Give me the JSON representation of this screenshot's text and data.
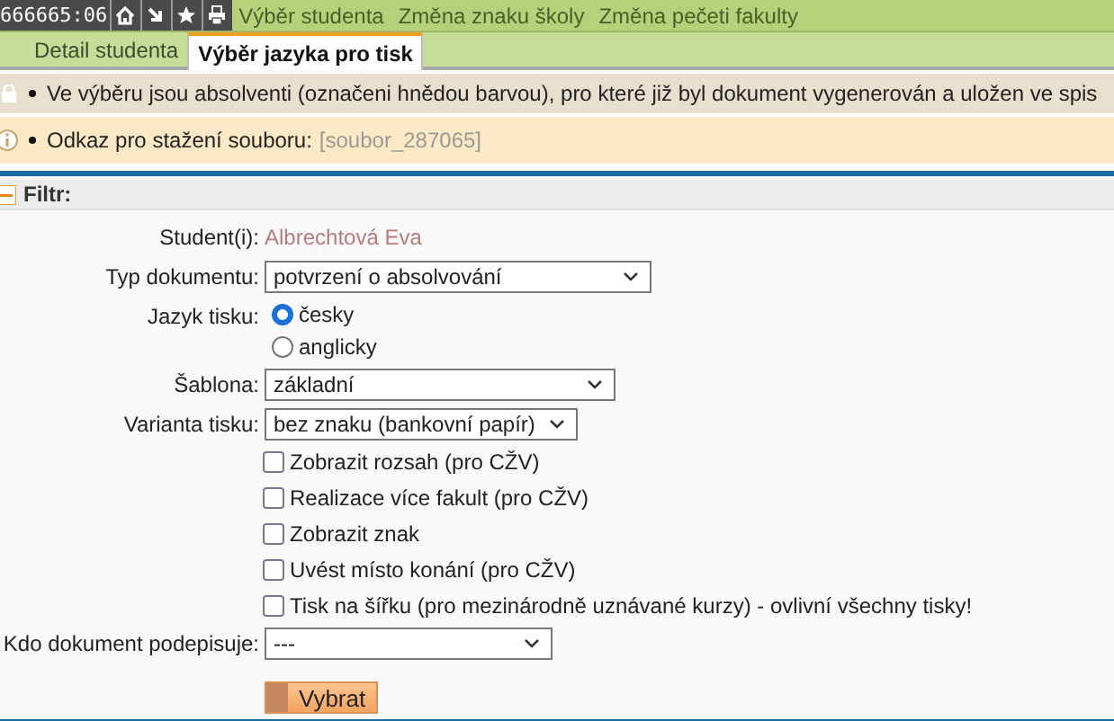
{
  "top_bar": {
    "session": "666665:06",
    "links": [
      {
        "label": "Výběr studenta"
      },
      {
        "label": "Změna znaku školy"
      },
      {
        "label": "Změna pečeti fakulty"
      }
    ]
  },
  "tabs": [
    {
      "label": "Detail studenta",
      "selected": false
    },
    {
      "label": "Výběr jazyka pro tisk",
      "selected": true
    }
  ],
  "notices": [
    {
      "kind": "warning",
      "text": "Ve výběru jsou absolventi (označeni hnědou barvou), pro které již byl dokument vygenerován a uložen ve spis"
    },
    {
      "kind": "info",
      "text": "Odkaz pro stažení souboru:",
      "link": "[soubor_287065]"
    }
  ],
  "filter": {
    "title": "Filtr:",
    "expanded": true,
    "fields": [
      {
        "kind": "text",
        "label": "Student(i):",
        "value": "Albrechtová Eva"
      },
      {
        "kind": "select",
        "label": "Typ dokumentu:",
        "value": "potvrzení o absolvování"
      },
      {
        "kind": "radio",
        "label": "Jazyk tisku:",
        "options": [
          {
            "label": "česky",
            "selected": true
          },
          {
            "label": "anglicky",
            "selected": false
          }
        ]
      },
      {
        "kind": "select",
        "label": "Šablona:",
        "value": "základní"
      },
      {
        "kind": "select",
        "label": "Varianta tisku:",
        "value": "bez znaku (bankovní papír)"
      },
      {
        "kind": "checkboxes",
        "options": [
          {
            "label": "Zobrazit rozsah (pro CŽV)",
            "checked": false
          },
          {
            "label": "Realizace více fakult (pro CŽV)",
            "checked": false
          },
          {
            "label": "Zobrazit znak",
            "checked": false
          },
          {
            "label": "Uvést místo konání (pro CŽV)",
            "checked": false
          },
          {
            "label": "Tisk na šířku (pro mezinárodně uznávané kurzy) - ovlivní všechny tisky!",
            "checked": false
          }
        ]
      },
      {
        "kind": "select",
        "label": "Kdo dokument podepisuje:",
        "value": "---"
      },
      {
        "kind": "button",
        "label": "Vybrat"
      }
    ]
  }
}
